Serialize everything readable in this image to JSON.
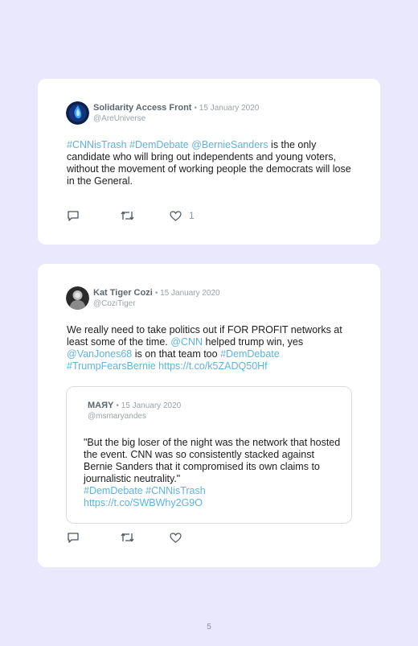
{
  "tweets": [
    {
      "author": "Solidarity Access Front",
      "date": "• 15 January 2020",
      "handle": "@AreUniverse",
      "text": {
        "l1": "#CNNisTrash",
        "l2": " ",
        "l3": "#DemDebate",
        "l4": " ",
        "l5": "@BernieSanders",
        "l6": " is the only candidate who will bring out independents and young voters, without the movement of working people the democrats will lose in the General."
      },
      "likes": "1"
    },
    {
      "author": "Kat Tiger Cozi",
      "date": "• 15 January 2020",
      "handle": "@CoziTiger",
      "text": {
        "p1": "We really need to take politics out if FOR PROFIT networks at least some of the time. ",
        "p2": "@CNN",
        "p3": " helped trump win, yes ",
        "p4": "@VanJones68",
        "p5": " is on that team too ",
        "p6": "#DemDebate",
        "p7": "#TrumpFearsBernie",
        "p8": " ",
        "p9": "https://t.co/k5ZADQ50Hf"
      },
      "quote": {
        "author": "MAЯY",
        "date": "• 15 January 2020",
        "handle": "@msmaryandes",
        "text": "\"But the big loser of the night was the network that hosted the event. CNN was so consistently stacked against Bernie Sanders that it compromised its own claims to journalistic neutrality.\"",
        "tag1": "#DemDebate",
        "tag2": "#CNNisTrash",
        "url": "https://t.co/SWBWhy2G9O"
      },
      "likes": ""
    }
  ],
  "page_number": "5",
  "colors": {
    "background": "#e9e8fc",
    "link": "#5fb3e0",
    "name": "#5b6770"
  },
  "icons": [
    "reply-icon",
    "retweet-icon",
    "heart-icon"
  ]
}
